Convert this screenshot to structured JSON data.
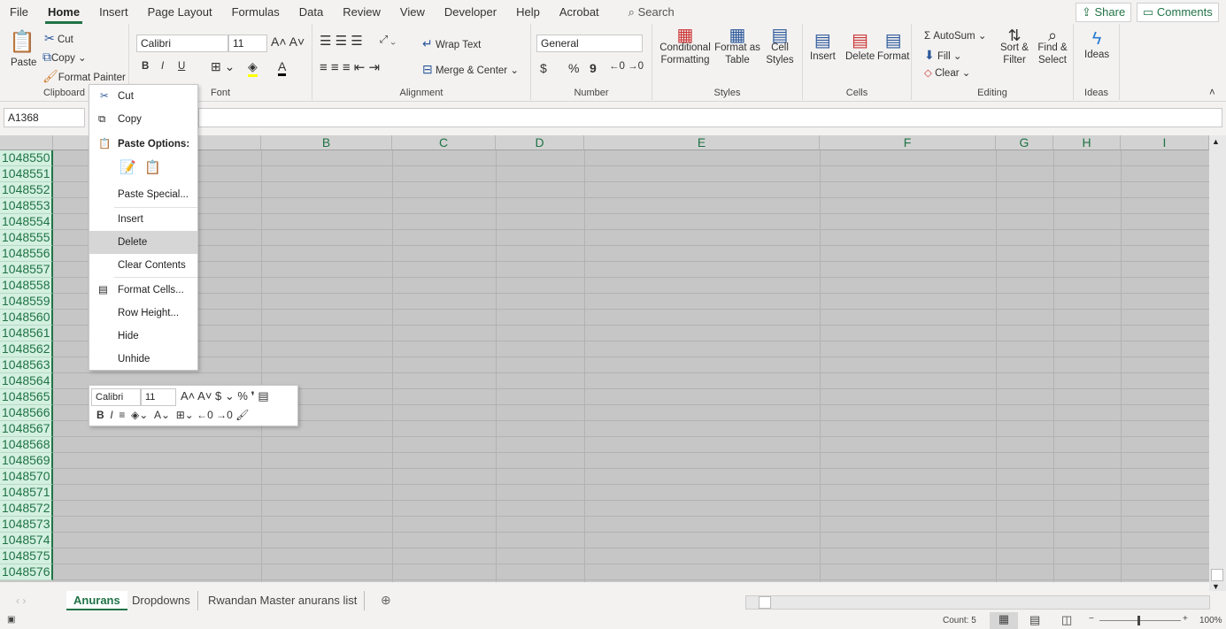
{
  "menu": {
    "tabs": [
      "File",
      "Home",
      "Insert",
      "Page Layout",
      "Formulas",
      "Data",
      "Review",
      "View",
      "Developer",
      "Help",
      "Acrobat"
    ],
    "active": "Home",
    "search": "Search",
    "share": "Share",
    "comments": "Comments"
  },
  "ribbon": {
    "clipboard": {
      "paste": "Paste",
      "cut": "Cut",
      "copy": "Copy",
      "format_painter": "Format Painter",
      "label": "Clipboard"
    },
    "font": {
      "name": "Calibri",
      "size": "11",
      "bold": "B",
      "italic": "I",
      "underline": "U",
      "label": "Font"
    },
    "alignment": {
      "wrap": "Wrap Text",
      "merge": "Merge & Center",
      "label": "Alignment"
    },
    "number": {
      "format": "General",
      "currency": "$",
      "percent": "%",
      "comma": "9",
      "label": "Number"
    },
    "styles": {
      "conditional": "Conditional Formatting",
      "format_table": "Format as Table",
      "cell_styles": "Cell Styles",
      "label": "Styles"
    },
    "cells": {
      "insert": "Insert",
      "delete": "Delete",
      "format": "Format",
      "label": "Cells"
    },
    "editing": {
      "autosum": "AutoSum",
      "fill": "Fill",
      "clear": "Clear",
      "sort": "Sort & Filter",
      "find": "Find & Select",
      "label": "Editing"
    },
    "ideas": {
      "ideas": "Ideas",
      "label": "Ideas"
    }
  },
  "formula_bar": {
    "name_box": "A1368",
    "formula": ""
  },
  "columns": [
    "B",
    "C",
    "D",
    "E",
    "F",
    "G",
    "H",
    "I"
  ],
  "rows": [
    "1048550",
    "1048551",
    "1048552",
    "1048553",
    "1048554",
    "1048555",
    "1048556",
    "1048557",
    "1048558",
    "1048559",
    "1048560",
    "1048561",
    "1048562",
    "1048563",
    "1048564",
    "1048565",
    "1048566",
    "1048567",
    "1048568",
    "1048569",
    "1048570",
    "1048571",
    "1048572",
    "1048573",
    "1048574",
    "1048575",
    "1048576"
  ],
  "context_menu": {
    "cut": "Cut",
    "copy": "Copy",
    "paste_options": "Paste Options:",
    "paste_special": "Paste Special...",
    "insert": "Insert",
    "delete": "Delete",
    "clear_contents": "Clear Contents",
    "format_cells": "Format Cells...",
    "row_height": "Row Height...",
    "hide": "Hide",
    "unhide": "Unhide",
    "highlighted": "Delete"
  },
  "mini_toolbar": {
    "font": "Calibri",
    "size": "11"
  },
  "sheets": {
    "tabs": [
      "Anurans",
      "Dropdowns",
      "Rwandan Master anurans list"
    ],
    "active": "Anurans"
  },
  "status": {
    "count": "Count: 5",
    "zoom": "100%"
  },
  "colors": {
    "accent": "#217346",
    "selection": "#c6c6c6"
  }
}
